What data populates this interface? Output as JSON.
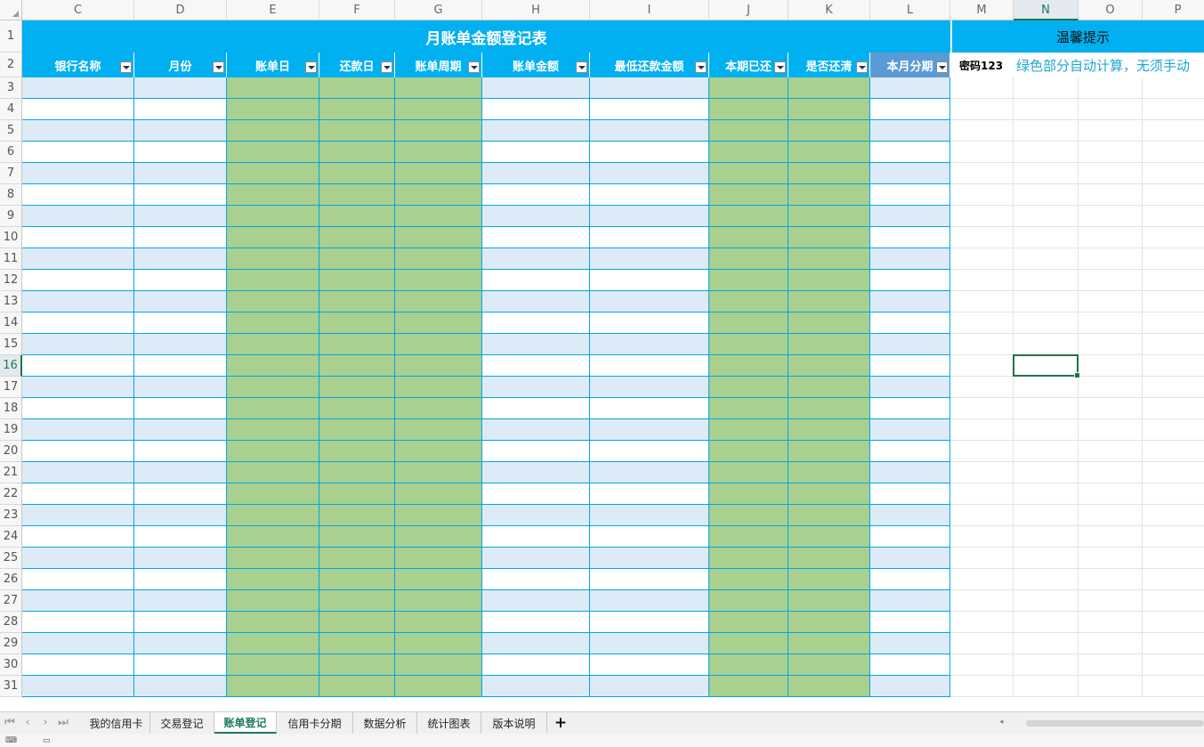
{
  "columns": [
    "C",
    "D",
    "E",
    "F",
    "G",
    "H",
    "I",
    "J",
    "K",
    "L",
    "M",
    "N",
    "O",
    "P"
  ],
  "selected_column": "N",
  "rows": [
    "1",
    "2",
    "3",
    "4",
    "5",
    "6",
    "7",
    "8",
    "9",
    "10",
    "11",
    "12",
    "13",
    "14",
    "15",
    "16",
    "17",
    "18",
    "19",
    "20",
    "21",
    "22",
    "23",
    "24",
    "25",
    "26",
    "27",
    "28",
    "29",
    "30",
    "31"
  ],
  "selected_row": "16",
  "sheet": {
    "title": "月账单金额登记表",
    "tip_title": "温馨提示",
    "password_label": "密码123",
    "note_text": "绿色部分自动计算，无须手动",
    "headers": [
      "银行名称",
      "月份",
      "账单日",
      "还款日",
      "账单周期",
      "账单金额",
      "最低还款金额",
      "本期已还",
      "是否还清",
      "本月分期"
    ],
    "auto_calc_columns": [
      "E",
      "F",
      "G",
      "J",
      "K"
    ]
  },
  "colors": {
    "title_blue": "#00b0f0",
    "header_last": "#5b9bd5",
    "band_blue": "#ddebf7",
    "auto_green": "#a9d08e",
    "note_text": "#1ca6d1",
    "selection": "#217346"
  },
  "tabs": [
    {
      "label": "我的信用卡",
      "active": false
    },
    {
      "label": "交易登记",
      "active": false
    },
    {
      "label": "账单登记",
      "active": true
    },
    {
      "label": "信用卡分期",
      "active": false
    },
    {
      "label": "数据分析",
      "active": false
    },
    {
      "label": "统计图表",
      "active": false
    },
    {
      "label": "版本说明",
      "active": false
    }
  ],
  "icons": {
    "nav_first": "⏮",
    "nav_prev": "‹",
    "nav_next": "›",
    "nav_last": "⏭",
    "add_sheet": "+"
  }
}
